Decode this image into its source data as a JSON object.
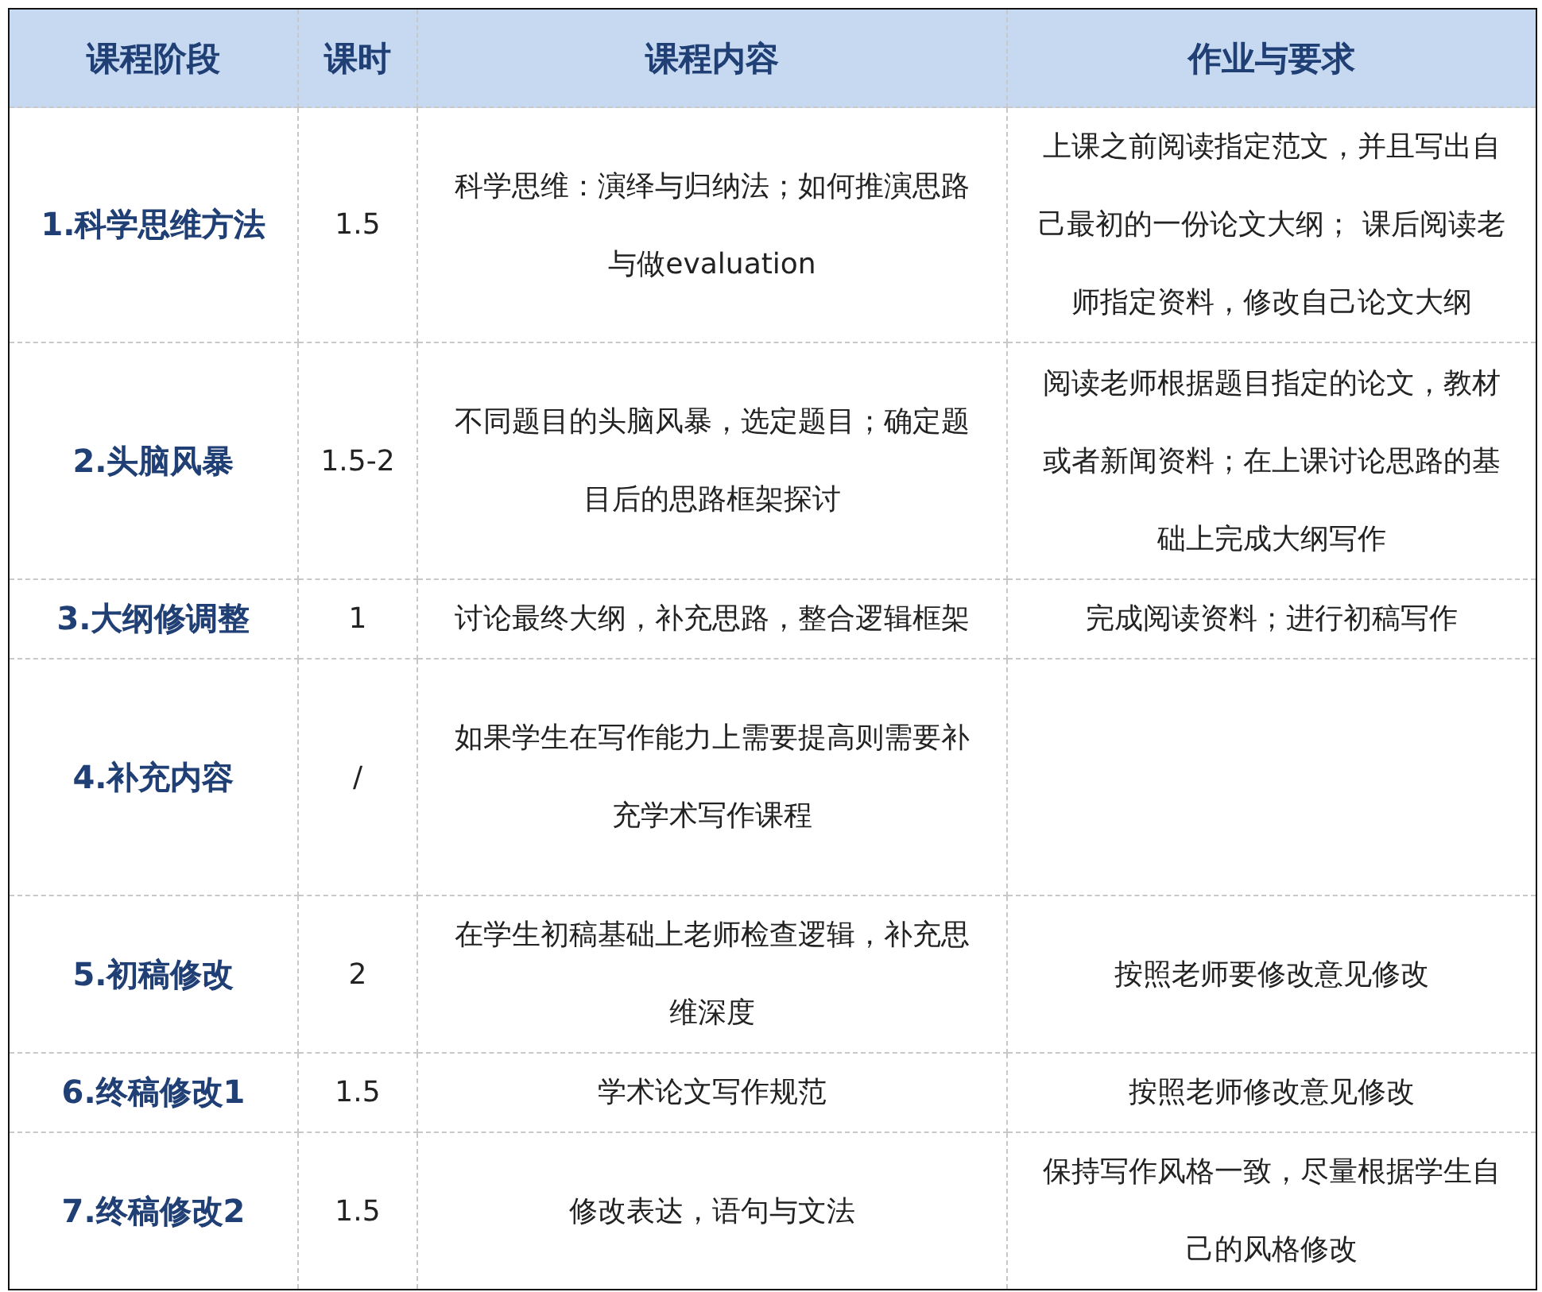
{
  "table": {
    "columns": [
      "课程阶段",
      "课时",
      "课程内容",
      "作业与要求"
    ],
    "rows": [
      {
        "stage": "1.科学思维方法",
        "hours": "1.5",
        "content": "科学思维：演绎与归纳法；如何推演思路与做evaluation",
        "homework": "上课之前阅读指定范文，并且写出自己最初的一份论文大纲； 课后阅读老师指定资料，修改自己论文大纲"
      },
      {
        "stage": "2.头脑风暴",
        "hours": "1.5-2",
        "content": "不同题目的头脑风暴，选定题目；确定题目后的思路框架探讨",
        "homework": "阅读老师根据题目指定的论文，教材或者新闻资料；在上课讨论思路的基础上完成大纲写作"
      },
      {
        "stage": "3.大纲修调整",
        "hours": "1",
        "content": "讨论最终大纲，补充思路，整合逻辑框架",
        "homework": "完成阅读资料；进行初稿写作"
      },
      {
        "stage": "4.补充内容",
        "hours": "/",
        "content": "如果学生在写作能力上需要提高则需要补充学术写作课程"
      },
      {
        "stage": "5.初稿修改",
        "hours": "2",
        "content": "在学生初稿基础上老师检查逻辑，补充思维深度",
        "homework": "按照老师要修改意见修改"
      },
      {
        "stage": "6.终稿修改1",
        "hours": "1.5",
        "content": "学术论文写作规范",
        "homework": "按照老师修改意见修改"
      },
      {
        "stage": "7.终稿修改2",
        "hours": "1.5",
        "content": "修改表达，语句与文法",
        "homework": "保持写作风格一致，尽量根据学生自己的风格修改"
      }
    ]
  }
}
